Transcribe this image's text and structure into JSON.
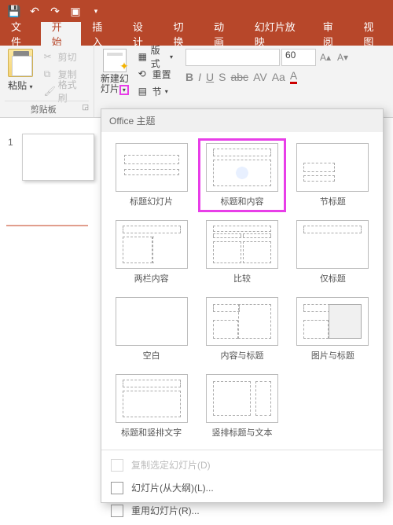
{
  "tabs": {
    "file": "文件",
    "home": "开始",
    "insert": "插入",
    "design": "设计",
    "transition": "切换",
    "animation": "动画",
    "slideshow": "幻灯片放映",
    "review": "审阅",
    "view": "视图"
  },
  "clipboard": {
    "paste": "粘贴",
    "cut": "剪切",
    "copy": "复制",
    "format_painter": "格式刷",
    "group": "剪贴板"
  },
  "slides": {
    "new_slide": "新建幻灯片",
    "layout": "版式",
    "reset": "重置",
    "section": "节"
  },
  "font": {
    "size": "60"
  },
  "dropdown": {
    "header": "Office 主题",
    "layouts": [
      {
        "id": "title",
        "label": "标题幻灯片"
      },
      {
        "id": "content",
        "label": "标题和内容"
      },
      {
        "id": "section",
        "label": "节标题"
      },
      {
        "id": "two",
        "label": "两栏内容"
      },
      {
        "id": "comp",
        "label": "比较"
      },
      {
        "id": "only",
        "label": "仅标题"
      },
      {
        "id": "blank",
        "label": "空白"
      },
      {
        "id": "cap",
        "label": "内容与标题"
      },
      {
        "id": "pic",
        "label": "图片与标题"
      },
      {
        "id": "vert",
        "label": "标题和竖排文字"
      },
      {
        "id": "vtt",
        "label": "竖排标题与文本"
      }
    ],
    "dup": "复制选定幻灯片(D)",
    "outline": "幻灯片(从大纲)(L)...",
    "reuse": "重用幻灯片(R)..."
  },
  "slide_panel": {
    "num": "1"
  }
}
